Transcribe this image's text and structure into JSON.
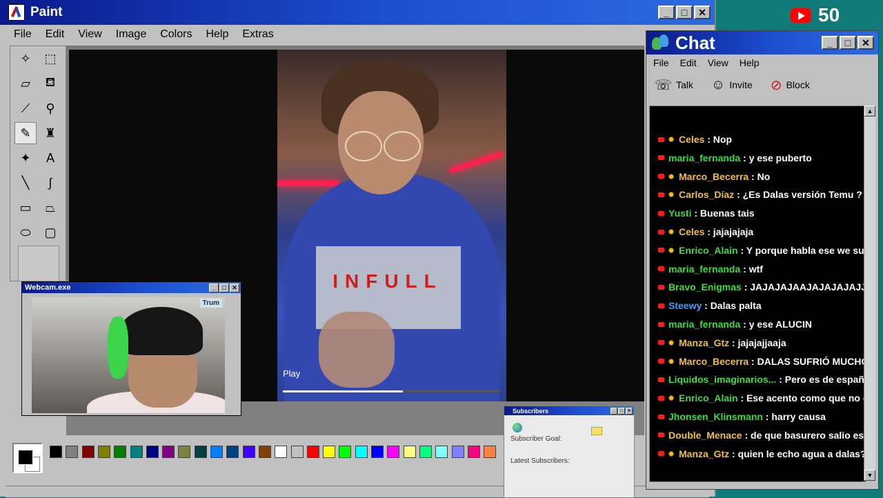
{
  "paint": {
    "title": "Paint",
    "menu": [
      "File",
      "Edit",
      "View",
      "Image",
      "Colors",
      "Help",
      "Extras"
    ],
    "tools": [
      "free-select-icon",
      "rect-select-icon",
      "eraser-icon",
      "fill-icon",
      "picker-icon",
      "magnifier-icon",
      "pencil-icon",
      "brush-icon",
      "airbrush-icon",
      "text-icon",
      "line-icon",
      "curve-icon",
      "rectangle-icon",
      "polygon-icon",
      "ellipse-icon",
      "rounded-rect-icon"
    ],
    "tool_text_glyph": "A",
    "palette": [
      "#000000",
      "#808080",
      "#800000",
      "#808000",
      "#008000",
      "#008080",
      "#000080",
      "#800080",
      "#808040",
      "#004040",
      "#0080ff",
      "#004080",
      "#4000ff",
      "#804000",
      "#ffffff",
      "#c0c0c0",
      "#ff0000",
      "#ffff00",
      "#00ff00",
      "#00ffff",
      "#0000ff",
      "#ff00ff",
      "#ffff80",
      "#00ff80",
      "#80ffff",
      "#8080ff",
      "#ff0080",
      "#ff8040"
    ]
  },
  "video": {
    "play_label": "Play",
    "print_text": "INFULL",
    "progress": 0.55
  },
  "webcam": {
    "title": "Webcam.exe",
    "label": "Trum"
  },
  "subscribers": {
    "title": "Subscribers",
    "goal_label": "Subscriber Goal:",
    "latest_label": "Latest Subscribers:"
  },
  "chat": {
    "title": "Chat",
    "menu": [
      "File",
      "Edit",
      "View",
      "Help"
    ],
    "toolbar": {
      "talk": "Talk",
      "invite": "Invite",
      "block": "Block"
    },
    "messages": [
      {
        "user": "Celes",
        "text": "Nop",
        "color": "#f0c040",
        "mod": true
      },
      {
        "user": "maria_fernanda",
        "text": "y ese puberto",
        "color": "#3ddc3d",
        "mod": false
      },
      {
        "user": "Marco_Becerra",
        "text": "No",
        "color": "#f0c040",
        "mod": true
      },
      {
        "user": "Carlos_Díaz",
        "text": "¿Es Dalas versión Temu ?",
        "color": "#f0c040",
        "mod": true
      },
      {
        "user": "Yusti",
        "text": "Buenas tais",
        "color": "#3ddc3d",
        "mod": false
      },
      {
        "user": "Celes",
        "text": "jajajajaja",
        "color": "#f0c040",
        "mod": true
      },
      {
        "user": "Enrico_Alain",
        "text": "Y porque habla ese we susurra",
        "color": "#3ddc3d",
        "mod": true
      },
      {
        "user": "maria_fernanda",
        "text": "wtf",
        "color": "#3ddc3d",
        "mod": false
      },
      {
        "user": "Bravo_Enigmas",
        "text": "JAJAJAJAAJAJAJAJAJJAJA",
        "color": "#3ddc3d",
        "mod": false
      },
      {
        "user": "Steewy",
        "text": "Dalas palta",
        "color": "#3aa0ff",
        "mod": false
      },
      {
        "user": "maria_fernanda",
        "text": "y ese ALUCIN",
        "color": "#3ddc3d",
        "mod": false
      },
      {
        "user": "Manza_Gtz",
        "text": "jajajajjaaja",
        "color": "#f0c040",
        "mod": true
      },
      {
        "user": "Marco_Becerra",
        "text": "DALAS SUFRIÓ MUCHO SH",
        "color": "#f0c040",
        "mod": true
      },
      {
        "user": "Liquidos_imaginarios...",
        "text": "Pero es de españistan",
        "color": "#3ddc3d",
        "mod": false
      },
      {
        "user": "Enrico_Alain",
        "text": "Ese acento como que no conve",
        "color": "#3ddc3d",
        "mod": true
      },
      {
        "user": "Jhonsen_Klinsmann",
        "text": "harry causa",
        "color": "#3ddc3d",
        "mod": false
      },
      {
        "user": "Double_Menace",
        "text": "de que basurero salio este?",
        "color": "#f0c040",
        "mod": false
      },
      {
        "user": "Manza_Gtz",
        "text": "quien le echo agua a dalas? le s",
        "color": "#f0c040",
        "mod": true
      }
    ]
  },
  "youtube": {
    "count": "50"
  }
}
